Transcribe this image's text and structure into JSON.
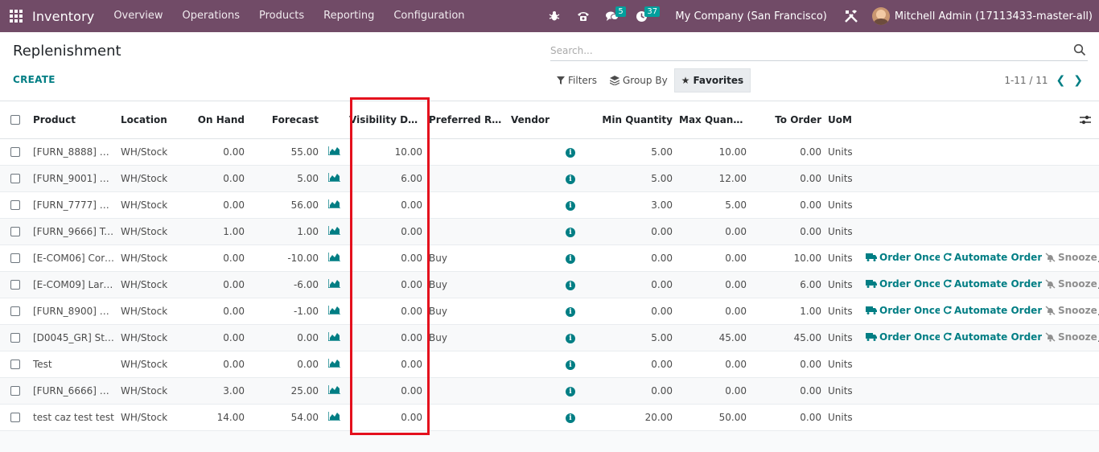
{
  "navbar": {
    "app_name": "Inventory",
    "menu": [
      "Overview",
      "Operations",
      "Products",
      "Reporting",
      "Configuration"
    ],
    "messages_count": "5",
    "activities_count": "37",
    "company": "My Company (San Francisco)",
    "user": "Mitchell Admin (17113433-master-all)",
    "bg_color": "#714b67"
  },
  "control": {
    "title": "Replenishment",
    "create_label": "CREATE",
    "search_placeholder": "Search...",
    "filters_label": "Filters",
    "group_by_label": "Group By",
    "favorites_label": "Favorites",
    "pager": "1-11 / 11"
  },
  "table": {
    "headers": {
      "product": "Product",
      "location": "Location",
      "on_hand": "On Hand",
      "forecast": "Forecast",
      "visibility_days": "Visibility Days",
      "preferred_route": "Preferred Rou...",
      "vendor": "Vendor",
      "min_qty": "Min Quantity",
      "max_qty": "Max Quantity",
      "to_order": "To Order",
      "uom": "UoM"
    },
    "action_labels": {
      "order_once": "Order Once",
      "automate": "Automate Orders",
      "snooze": "Snooze"
    },
    "rows": [
      {
        "product": "[FURN_8888] O...",
        "location": "WH/Stock",
        "on_hand": "0.00",
        "forecast": "55.00",
        "visibility": "10.00",
        "route": "",
        "min": "5.00",
        "max": "10.00",
        "to_order": "0.00",
        "uom": "Units",
        "actions": false
      },
      {
        "product": "[FURN_9001] Fli...",
        "location": "WH/Stock",
        "on_hand": "0.00",
        "forecast": "5.00",
        "visibility": "6.00",
        "route": "",
        "min": "5.00",
        "max": "12.00",
        "to_order": "0.00",
        "uom": "Units",
        "actions": false
      },
      {
        "product": "[FURN_7777] O...",
        "location": "WH/Stock",
        "on_hand": "0.00",
        "forecast": "56.00",
        "visibility": "0.00",
        "route": "",
        "min": "3.00",
        "max": "5.00",
        "to_order": "0.00",
        "uom": "Units",
        "actions": false
      },
      {
        "product": "[FURN_9666] Ta...",
        "location": "WH/Stock",
        "on_hand": "1.00",
        "forecast": "1.00",
        "visibility": "0.00",
        "route": "",
        "min": "0.00",
        "max": "0.00",
        "to_order": "0.00",
        "uom": "Units",
        "actions": false
      },
      {
        "product": "[E-COM06] Corn...",
        "location": "WH/Stock",
        "on_hand": "0.00",
        "forecast": "-10.00",
        "visibility": "0.00",
        "route": "Buy",
        "min": "0.00",
        "max": "0.00",
        "to_order": "10.00",
        "uom": "Units",
        "actions": true
      },
      {
        "product": "[E-COM09] Larg...",
        "location": "WH/Stock",
        "on_hand": "0.00",
        "forecast": "-6.00",
        "visibility": "0.00",
        "route": "Buy",
        "min": "0.00",
        "max": "0.00",
        "to_order": "6.00",
        "uom": "Units",
        "actions": true
      },
      {
        "product": "[FURN_8900] Dr...",
        "location": "WH/Stock",
        "on_hand": "0.00",
        "forecast": "-1.00",
        "visibility": "0.00",
        "route": "Buy",
        "min": "0.00",
        "max": "0.00",
        "to_order": "1.00",
        "uom": "Units",
        "actions": true
      },
      {
        "product": "[D0045_GR] Sto...",
        "location": "WH/Stock",
        "on_hand": "0.00",
        "forecast": "0.00",
        "visibility": "0.00",
        "route": "Buy",
        "min": "5.00",
        "max": "45.00",
        "to_order": "45.00",
        "uom": "Units",
        "actions": true
      },
      {
        "product": "Test",
        "location": "WH/Stock",
        "on_hand": "0.00",
        "forecast": "0.00",
        "visibility": "0.00",
        "route": "",
        "min": "0.00",
        "max": "0.00",
        "to_order": "0.00",
        "uom": "Units",
        "actions": false
      },
      {
        "product": "[FURN_6666] A...",
        "location": "WH/Stock",
        "on_hand": "3.00",
        "forecast": "25.00",
        "visibility": "0.00",
        "route": "",
        "min": "0.00",
        "max": "0.00",
        "to_order": "0.00",
        "uom": "Units",
        "actions": false
      },
      {
        "product": "test caz test test",
        "location": "WH/Stock",
        "on_hand": "14.00",
        "forecast": "54.00",
        "visibility": "0.00",
        "route": "",
        "min": "20.00",
        "max": "50.00",
        "to_order": "0.00",
        "uom": "Units",
        "actions": false
      }
    ]
  },
  "highlight_color": "#e4101d"
}
